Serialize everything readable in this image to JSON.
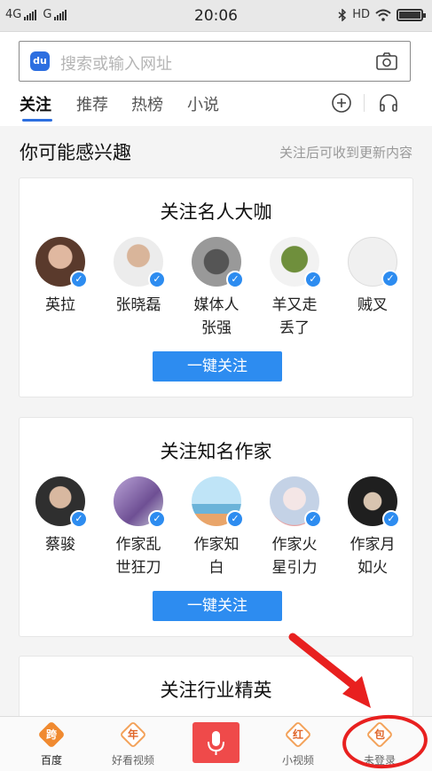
{
  "status_bar": {
    "left": [
      "4G",
      "G"
    ],
    "time": "20:06",
    "hd": "HD"
  },
  "search": {
    "placeholder": "搜索或输入网址",
    "logo_text": "du",
    "camera_icon": "camera-icon"
  },
  "tabs": [
    {
      "label": "关注",
      "active": true
    },
    {
      "label": "推荐",
      "active": false
    },
    {
      "label": "热榜",
      "active": false
    },
    {
      "label": "小说",
      "active": false
    }
  ],
  "tab_actions": [
    "add-circle-icon",
    "headphones-icon"
  ],
  "feed": {
    "title": "你可能感兴趣",
    "hint": "关注后可收到更新内容"
  },
  "cards": [
    {
      "title": "关注名人大咖",
      "people": [
        {
          "name": "英拉",
          "name2": "",
          "avatar_color": "#6b4a3a"
        },
        {
          "name": "张晓磊",
          "name2": "",
          "avatar_color": "#4a4a4a"
        },
        {
          "name": "媒体人",
          "name2": "张强",
          "avatar_color": "#777777"
        },
        {
          "name": "羊又走",
          "name2": "丢了",
          "avatar_color": "#7c9a4a"
        },
        {
          "name": "贼叉",
          "name2": "",
          "avatar_color": "#e8e8e8"
        }
      ],
      "button": "一键关注"
    },
    {
      "title": "关注知名作家",
      "people": [
        {
          "name": "蔡骏",
          "name2": "",
          "avatar_color": "#3a3a3a"
        },
        {
          "name": "作家乱",
          "name2": "世狂刀",
          "avatar_color": "#9b7fb8"
        },
        {
          "name": "作家知",
          "name2": "白",
          "avatar_color": "#8fc7e8"
        },
        {
          "name": "作家火",
          "name2": "星引力",
          "avatar_color": "#c9d6e8"
        },
        {
          "name": "作家月",
          "name2": "如火",
          "avatar_color": "#2c2c2c"
        }
      ],
      "button": "一键关注"
    },
    {
      "title": "关注行业精英"
    }
  ],
  "bottom_nav": [
    {
      "label": "百度",
      "char": "跨",
      "color": "#f08a30",
      "active": true
    },
    {
      "label": "好看视频",
      "char": "年",
      "color": "#f3a25a",
      "active": false
    },
    {
      "label": "小视频",
      "char": "红",
      "color": "#f3a25a",
      "active": false
    },
    {
      "label": "未登录",
      "char": "包",
      "color": "#f3a25a",
      "active": false
    }
  ],
  "mic_icon": "microphone-icon",
  "colors": {
    "accent": "#2d8cf0",
    "annotation": "#e8201f"
  }
}
